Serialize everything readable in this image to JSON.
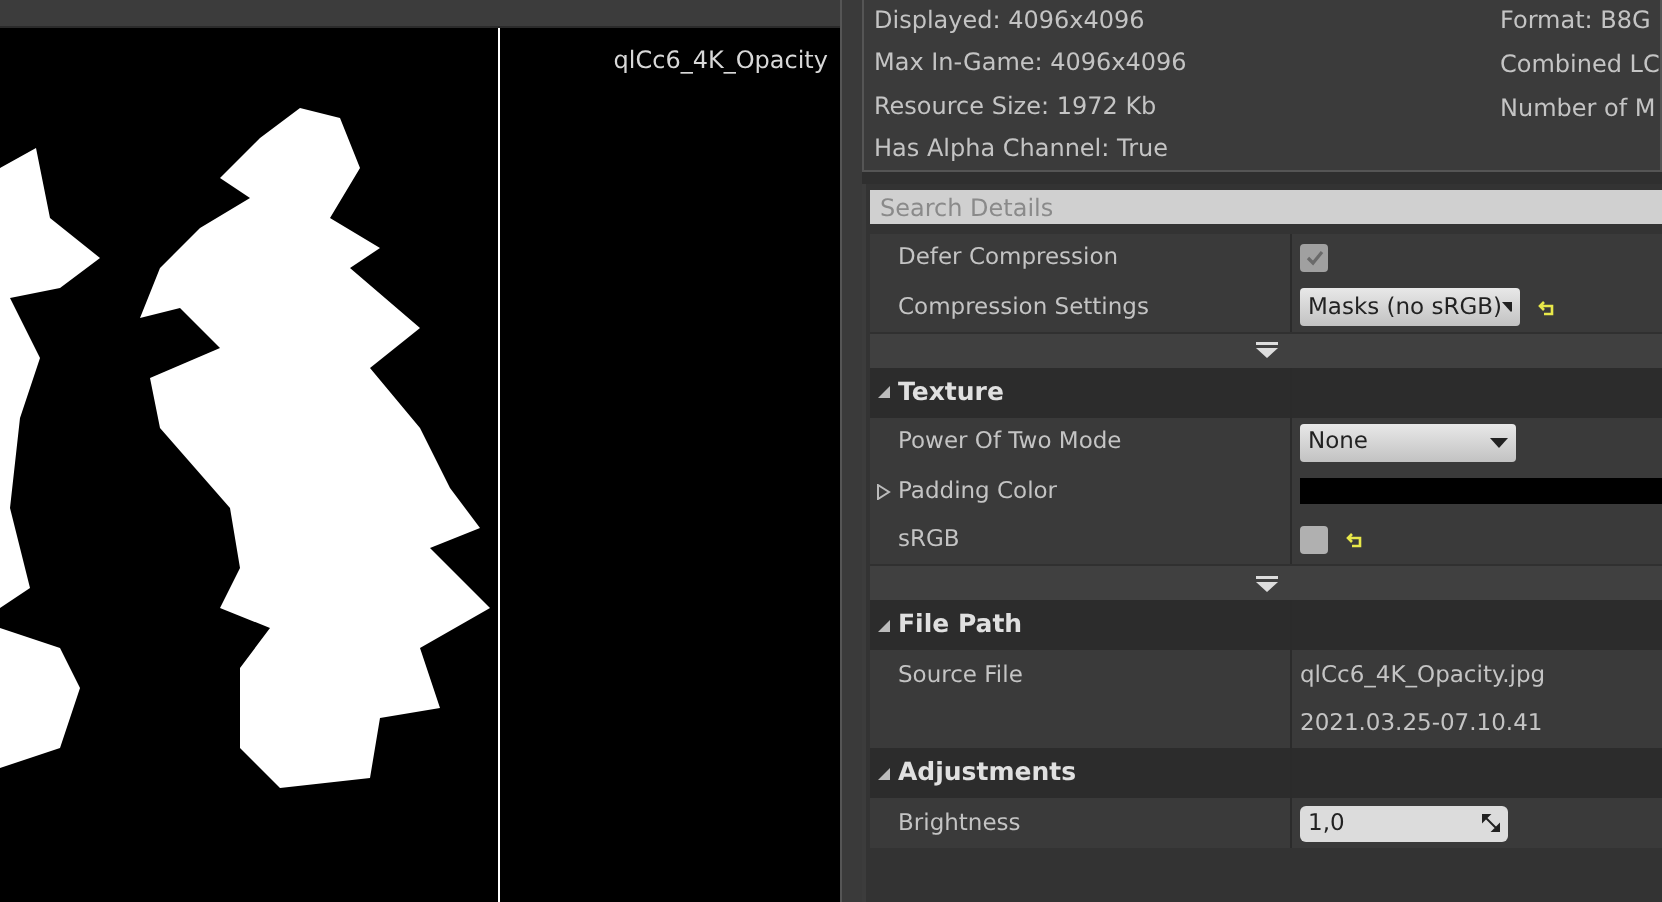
{
  "viewport": {
    "label": "qlCc6_4K_Opacity"
  },
  "info": {
    "left": [
      "Displayed: 4096x4096",
      "Max In-Game: 4096x4096",
      "Resource Size: 1972 Kb",
      "Has Alpha Channel: True"
    ],
    "right": [
      "Format: B8G",
      "Combined LC",
      "Number of M"
    ]
  },
  "details": {
    "search": {
      "placeholder": "Search Details"
    },
    "rows": [
      {
        "kind": "checkbox",
        "label": "Defer Compression",
        "checked": true,
        "disabled": true,
        "reset_to_default": false
      },
      {
        "kind": "combo",
        "label": "Compression Settings",
        "value": "Masks (no sRGB)",
        "reset_to_default": true
      },
      {
        "kind": "advanced"
      },
      {
        "kind": "header",
        "label": "Texture",
        "expanded": true
      },
      {
        "kind": "combo",
        "label": "Power Of Two Mode",
        "value": "None",
        "reset_to_default": false
      },
      {
        "kind": "color",
        "label": "Padding Color",
        "color": "#000000",
        "expanded": false
      },
      {
        "kind": "checkbox",
        "label": "sRGB",
        "checked": false,
        "disabled": false,
        "reset_to_default": true
      },
      {
        "kind": "advanced"
      },
      {
        "kind": "header",
        "label": "File Path",
        "expanded": true
      },
      {
        "kind": "text",
        "label": "Source File",
        "value": "qlCc6_4K_Opacity.jpg"
      },
      {
        "kind": "text",
        "value": "2021.03.25-07.10.41"
      },
      {
        "kind": "header",
        "label": "Adjustments",
        "expanded": true
      },
      {
        "kind": "number",
        "label": "Brightness",
        "value": "1,0"
      }
    ]
  }
}
